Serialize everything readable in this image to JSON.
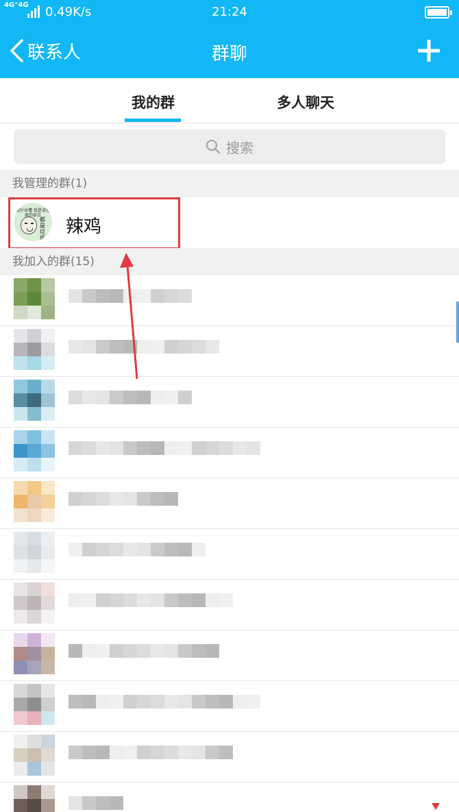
{
  "statusbar": {
    "network": "4G⁺4G",
    "speed": "0.49K/s",
    "time": "21:24"
  },
  "header": {
    "back_label": "联系人",
    "title": "群聊"
  },
  "tabs": [
    {
      "label": "我的群",
      "active": true
    },
    {
      "label": "多人聊天",
      "active": false
    }
  ],
  "search": {
    "placeholder": "搜索"
  },
  "managed": {
    "header": "我管理的群(1)",
    "groups": [
      {
        "name": "辣鸡",
        "avatar_caption": "被针对懂 我是说在座的各位",
        "avatar_side_text": "都是垃圾"
      }
    ]
  },
  "joined": {
    "header": "我加入的群(15)"
  },
  "colors": {
    "accent": "#12b7f5",
    "annotation": "#e3393f"
  }
}
